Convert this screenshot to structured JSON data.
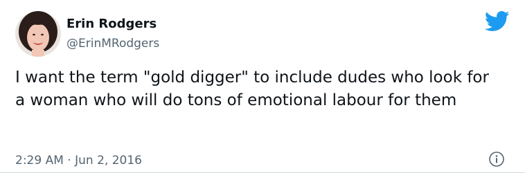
{
  "author": {
    "name": "Erin Rodgers",
    "handle": "@ErinMRodgers"
  },
  "tweet": {
    "text": "I want the term \"gold digger\" to include dudes who look for a woman who will do tons of emotional labour for them",
    "time": "2:29 AM",
    "separator": "·",
    "date": "Jun 2, 2016"
  },
  "icons": {
    "brand": "twitter-bird-icon",
    "info": "info-icon"
  },
  "colors": {
    "twitter_blue": "#1d9bf0",
    "text_primary": "#0f1419",
    "text_secondary": "#536471"
  }
}
